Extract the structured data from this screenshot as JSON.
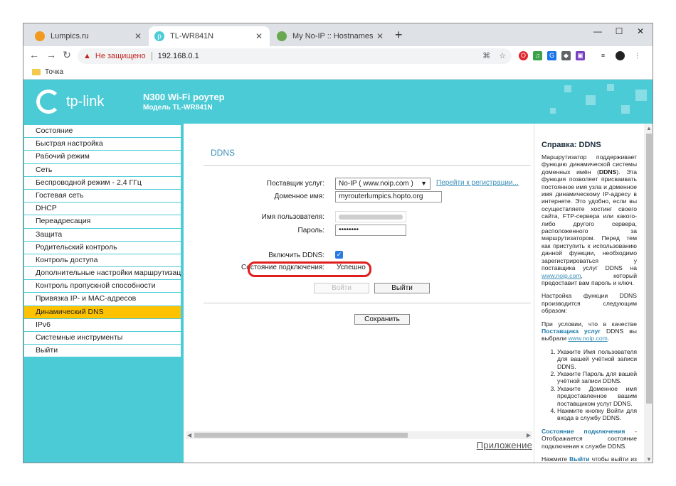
{
  "browser": {
    "tabs": [
      {
        "title": "Lumpics.ru",
        "active": false
      },
      {
        "title": "TL-WR841N",
        "active": true
      },
      {
        "title": "My No-IP :: Hostnames",
        "active": false
      }
    ],
    "new_tab": "+",
    "insecure_label": "Не защищено",
    "url": "192.168.0.1",
    "bookmark": "Точка"
  },
  "header": {
    "brand": "tp-link",
    "title": "N300 Wi-Fi роутер",
    "model": "Модель TL-WR841N"
  },
  "menu": {
    "items": [
      "Состояние",
      "Быстрая настройка",
      "Рабочий режим",
      "Сеть",
      "Беспроводной режим - 2,4 ГГц",
      "Гостевая сеть",
      "DHCP",
      "Переадресация",
      "Защита",
      "Родительский контроль",
      "Контроль доступа",
      "Дополнительные настройки маршрутизации",
      "Контроль пропускной способности",
      "Привязка IP- и MAC-адресов",
      "Динамический DNS",
      "IPv6",
      "Системные инструменты",
      "Выйти"
    ],
    "active_index": 14
  },
  "ddns": {
    "title": "DDNS",
    "provider_label": "Поставщик услуг:",
    "provider_value": "No-IP ( www.noip.com )",
    "register_link": "Перейти к регистрации...",
    "domain_label": "Доменное имя:",
    "domain_value": "myrouterlumpics.hopto.org",
    "username_label": "Имя пользователя:",
    "password_label": "Пароль:",
    "password_value": "••••••••",
    "enable_label": "Включить DDNS:",
    "enabled": true,
    "status_label": "Состояние подключения:",
    "status_value": "Успешно",
    "login_button": "Войти",
    "logout_button": "Выйти",
    "save_button": "Сохранить",
    "app_link": "Приложение"
  },
  "help": {
    "title": "Справка: DDNS",
    "intro_1": "Маршрутизатор поддерживает функцию динамической системы доменных имён (",
    "intro_ddns": "DDNS",
    "intro_2": "). Эта функция позволяет присваивать постоянное имя узла и доменное имя динамическому IP-адресу в интернете. Это удобно, если вы осуществляете хостинг своего сайта, FTP-сервера или какого-либо другого сервера, расположенного за маршрутизатором. Перед тем как приступить к использованию данной функции, необходимо зарегистрироваться у поставщика услуг DDNS на ",
    "intro_link": "www.noip.com",
    "intro_3": ", который предоставит вам пароль и ключ.",
    "setup": "Настройка функции DDNS производится следующим образом:",
    "cond_1": "При условии, что в качестве ",
    "cond_bold": "Поставщика услуг",
    "cond_2": " DDNS вы выбрали ",
    "cond_link": "www.noip.com",
    "cond_3": ".",
    "steps": [
      "Укажите Имя пользователя для вашей учётной записи DDNS.",
      "Укажите Пароль для вашей учётной записи DDNS.",
      "Укажите Доменное имя предоставленное вашим поставщиком услуг DDNS.",
      "Нажмите кнопку Войти для входа в службу DDNS."
    ],
    "status_term": "Состояние подключения",
    "status_desc": " - Отображается состояние подключения к службе DDNS.",
    "logout_1": "Нажмите ",
    "logout_term": "Выйти",
    "logout_2": " чтобы выйти из службы DDNS."
  }
}
